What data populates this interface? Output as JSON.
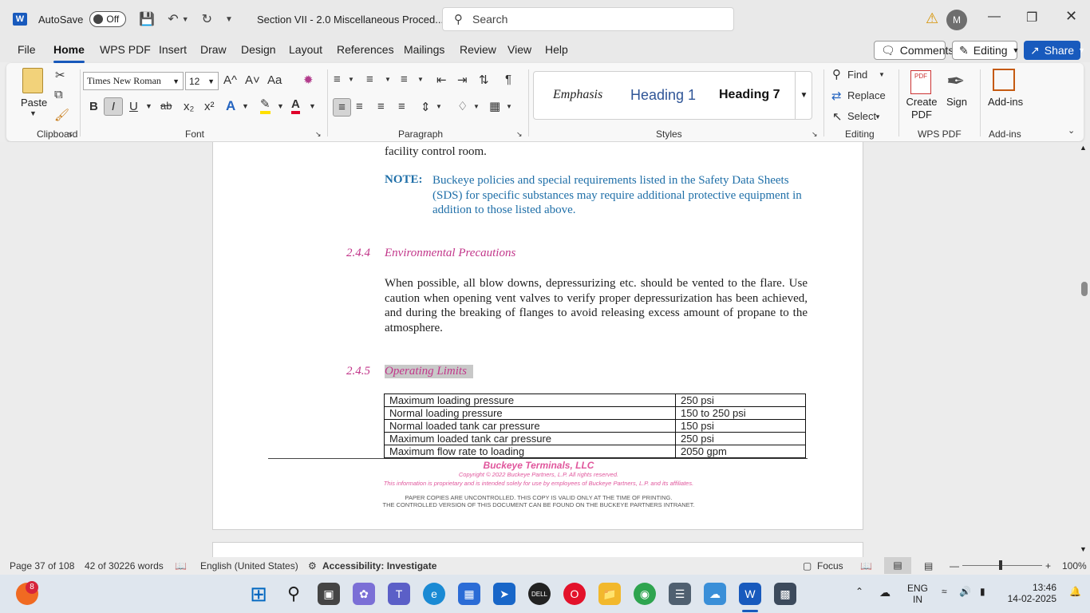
{
  "titlebar": {
    "app_logo": "W",
    "autosave_label": "AutoSave",
    "autosave_state": "Off",
    "doc_title": "Section VII - 2.0 Miscellaneous Proced...",
    "search_placeholder": "Search",
    "avatar_initial": "M"
  },
  "tabs": [
    "File",
    "Home",
    "WPS PDF",
    "Insert",
    "Draw",
    "Design",
    "Layout",
    "References",
    "Mailings",
    "Review",
    "View",
    "Help"
  ],
  "actions": {
    "comments": "Comments",
    "editing": "Editing",
    "share": "Share"
  },
  "ribbon": {
    "clipboard": {
      "paste": "Paste",
      "label": "Clipboard"
    },
    "font": {
      "name": "Times New Roman",
      "size": "12",
      "label": "Font",
      "bold": "B",
      "italic": "I",
      "underline": "U",
      "strike": "ab",
      "sub": "x₂",
      "sup": "x²",
      "grow": "A^",
      "shrink": "A˅",
      "case": "Aa"
    },
    "paragraph": {
      "label": "Paragraph"
    },
    "styles": {
      "label": "Styles",
      "items": [
        "Emphasis",
        "Heading 1",
        "Heading 7"
      ]
    },
    "editing": {
      "find": "Find",
      "replace": "Replace",
      "select": "Select",
      "label": "Editing"
    },
    "wps": {
      "create_pdf": "Create PDF",
      "sign": "Sign",
      "label": "WPS PDF"
    },
    "addins": {
      "button": "Add-ins",
      "label": "Add-ins"
    }
  },
  "document": {
    "top_fragment": "facility control room.",
    "note_label": "NOTE:",
    "note_text": "Buckeye policies and special requirements listed in the Safety Data Sheets (SDS) for specific substances may require additional protective equipment in addition to those listed above.",
    "sec1_num": "2.4.4",
    "sec1_title": "Environmental Precautions",
    "sec1_body": "When possible, all blow downs, depressurizing etc. should be vented to the flare. Use caution when opening vent valves to verify proper depressurization has been achieved, and during the breaking of flanges to avoid releasing excess amount of propane to the atmosphere.",
    "sec2_num": "2.4.5",
    "sec2_title": "Operating Limits",
    "limits": [
      {
        "param": "Maximum loading pressure",
        "value": "250 psi"
      },
      {
        "param": "Normal loading pressure",
        "value": "150 to 250 psi"
      },
      {
        "param": "Normal loaded tank car pressure",
        "value": "150 psi"
      },
      {
        "param": "Maximum loaded tank car pressure",
        "value": "250 psi"
      },
      {
        "param": "Maximum flow rate to loading",
        "value": "2050 gpm"
      }
    ],
    "footer": {
      "company": "Buckeye Terminals, LLC",
      "copyright": "Copyright © 2022 Buckeye Partners, L.P. All rights reserved.",
      "proprietary": "This information is proprietary and is intended solely for use by employees of Buckeye Partners, L.P. and its affiliates.",
      "uncontrolled": "PAPER COPIES ARE UNCONTROLLED. THIS COPY IS VALID ONLY AT THE TIME OF PRINTING.",
      "controlled": "THE CONTROLLED VERSION OF THIS DOCUMENT CAN BE FOUND ON THE BUCKEYE PARTNERS INTRANET."
    }
  },
  "status": {
    "page": "Page 37 of 108",
    "words": "42 of 30226 words",
    "language": "English (United States)",
    "accessibility": "Accessibility: Investigate",
    "focus": "Focus",
    "zoom": "100%"
  },
  "taskbar": {
    "badge": "8",
    "lang_top": "ENG",
    "lang_bottom": "IN",
    "time": "13:46",
    "date": "14-02-2025"
  },
  "colors": {
    "accent": "#185abd",
    "note": "#1f6fa8",
    "heading": "#c2368a",
    "footer_pink": "#e0569c"
  }
}
